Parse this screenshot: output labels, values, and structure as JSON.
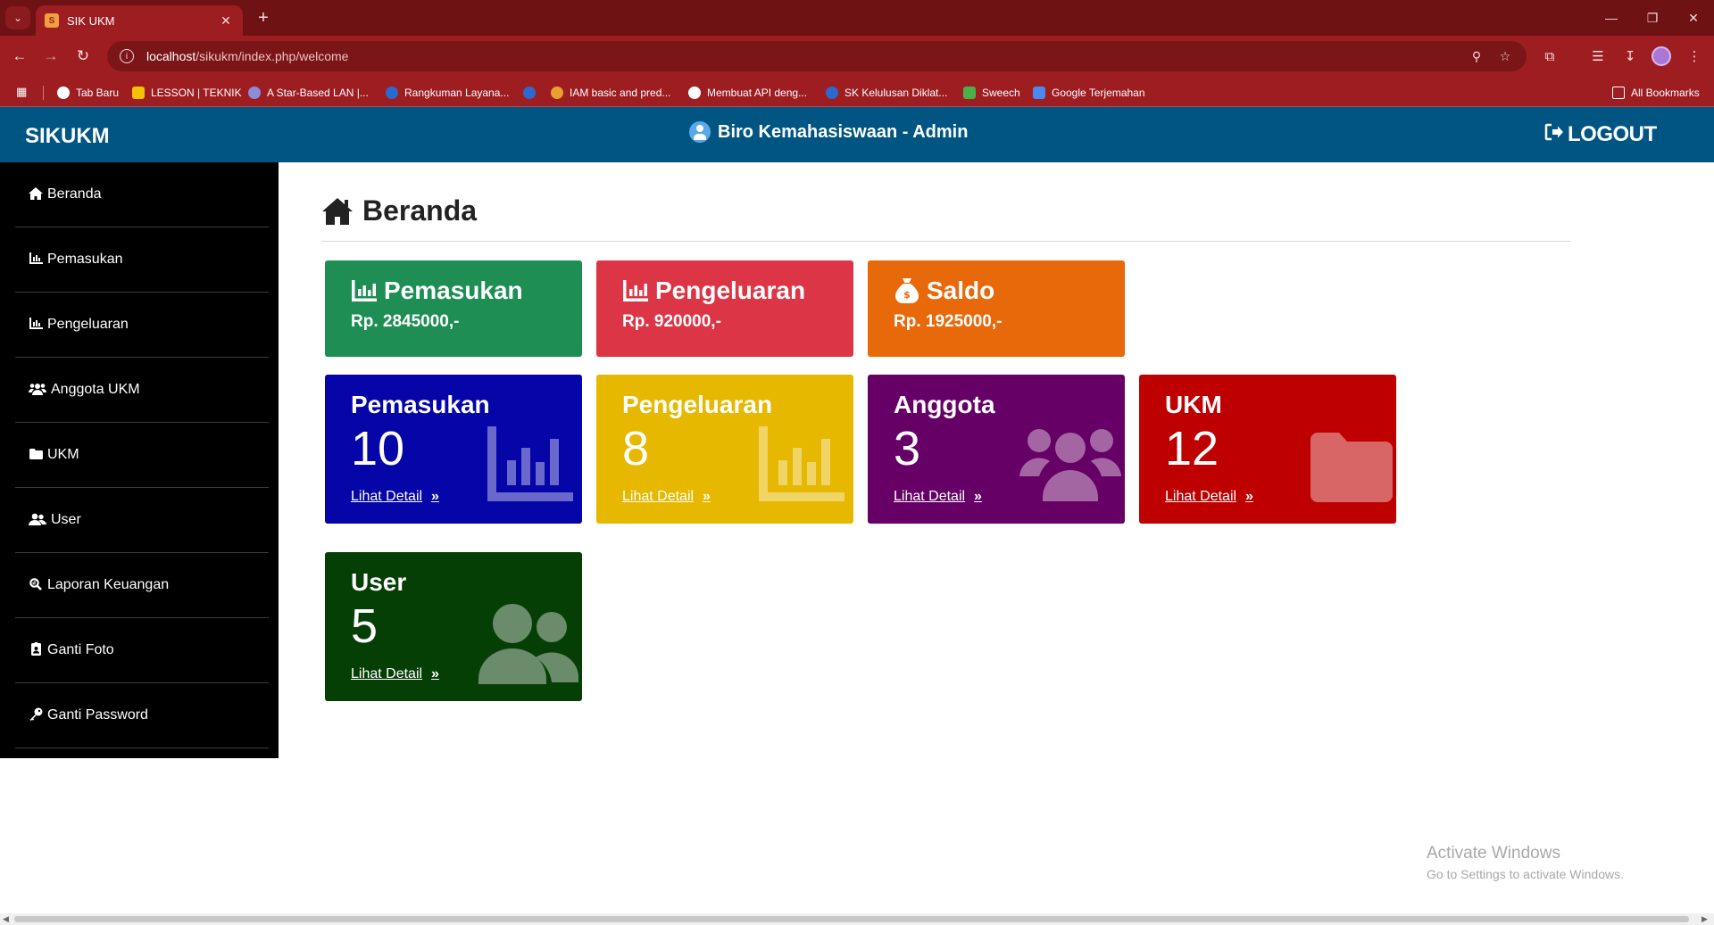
{
  "browser": {
    "tab_title": "SIK UKM",
    "tab_favicon": "sikukm-favicon",
    "url_host": "localhost",
    "url_path": "/sikukm/index.php/welcome",
    "bookmarks": [
      {
        "label": "Tab Baru",
        "color": "#ffffff"
      },
      {
        "label": "LESSON | TEKNIK",
        "color": "#f2c200"
      },
      {
        "label": "A Star-Based LAN |...",
        "color": "#8c8cd8"
      },
      {
        "label": "Rangkuman Layana...",
        "color": "#2a6ad0"
      },
      {
        "label": "",
        "color": "#2a6ad0"
      },
      {
        "label": "IAM basic and pred...",
        "color": "#e8a030"
      },
      {
        "label": "Membuat API deng...",
        "color": "#ffffff"
      },
      {
        "label": "SK Kelulusan Diklat...",
        "color": "#2a6ad0"
      },
      {
        "label": "Sweech",
        "color": "#4ab04a"
      },
      {
        "label": "Google Terjemahan",
        "color": "#4a8af0"
      }
    ],
    "all_bookmarks": "All Bookmarks"
  },
  "header": {
    "brand": "SIKUKM",
    "user": "Biro Kemahasiswaan - Admin",
    "logout": "LOGOUT"
  },
  "sidebar": {
    "items": [
      {
        "label": "Beranda",
        "icon": "home-icon"
      },
      {
        "label": "Pemasukan",
        "icon": "bar-chart-icon"
      },
      {
        "label": "Pengeluaran",
        "icon": "bar-chart-icon"
      },
      {
        "label": "Anggota UKM",
        "icon": "users-icon"
      },
      {
        "label": "UKM",
        "icon": "folder-icon"
      },
      {
        "label": "User",
        "icon": "user-group-icon"
      },
      {
        "label": "Laporan Keuangan",
        "icon": "search-icon"
      },
      {
        "label": "Ganti Foto",
        "icon": "id-badge-icon"
      },
      {
        "label": "Ganti Password",
        "icon": "key-icon"
      }
    ]
  },
  "main": {
    "title": "Beranda",
    "summary": [
      {
        "label": "Pemasukan",
        "value": "Rp. 2845000,-",
        "color": "#1e8e55",
        "icon": "bar-chart-icon"
      },
      {
        "label": "Pengeluaran",
        "value": "Rp. 920000,-",
        "color": "#dc3545",
        "icon": "bar-chart-icon"
      },
      {
        "label": "Saldo",
        "value": "Rp. 1925000,-",
        "color": "#e8690a",
        "icon": "money-bag-icon"
      }
    ],
    "stats": [
      {
        "label": "Pemasukan",
        "count": "10",
        "link": "Lihat Detail",
        "color": "#0505a8",
        "icon": "bar-chart-icon"
      },
      {
        "label": "Pengeluaran",
        "count": "8",
        "link": "Lihat Detail",
        "color": "#e6b800",
        "icon": "bar-chart-icon"
      },
      {
        "label": "Anggota",
        "count": "3",
        "link": "Lihat Detail",
        "color": "#660066",
        "icon": "users-icon"
      },
      {
        "label": "UKM",
        "count": "12",
        "link": "Lihat Detail",
        "color": "#bf0000",
        "icon": "folder-icon"
      },
      {
        "label": "User",
        "count": "5",
        "link": "Lihat Detail",
        "color": "#063f06",
        "icon": "user-group-icon"
      }
    ]
  },
  "watermark": {
    "line1": "Activate Windows",
    "line2": "Go to Settings to activate Windows."
  }
}
